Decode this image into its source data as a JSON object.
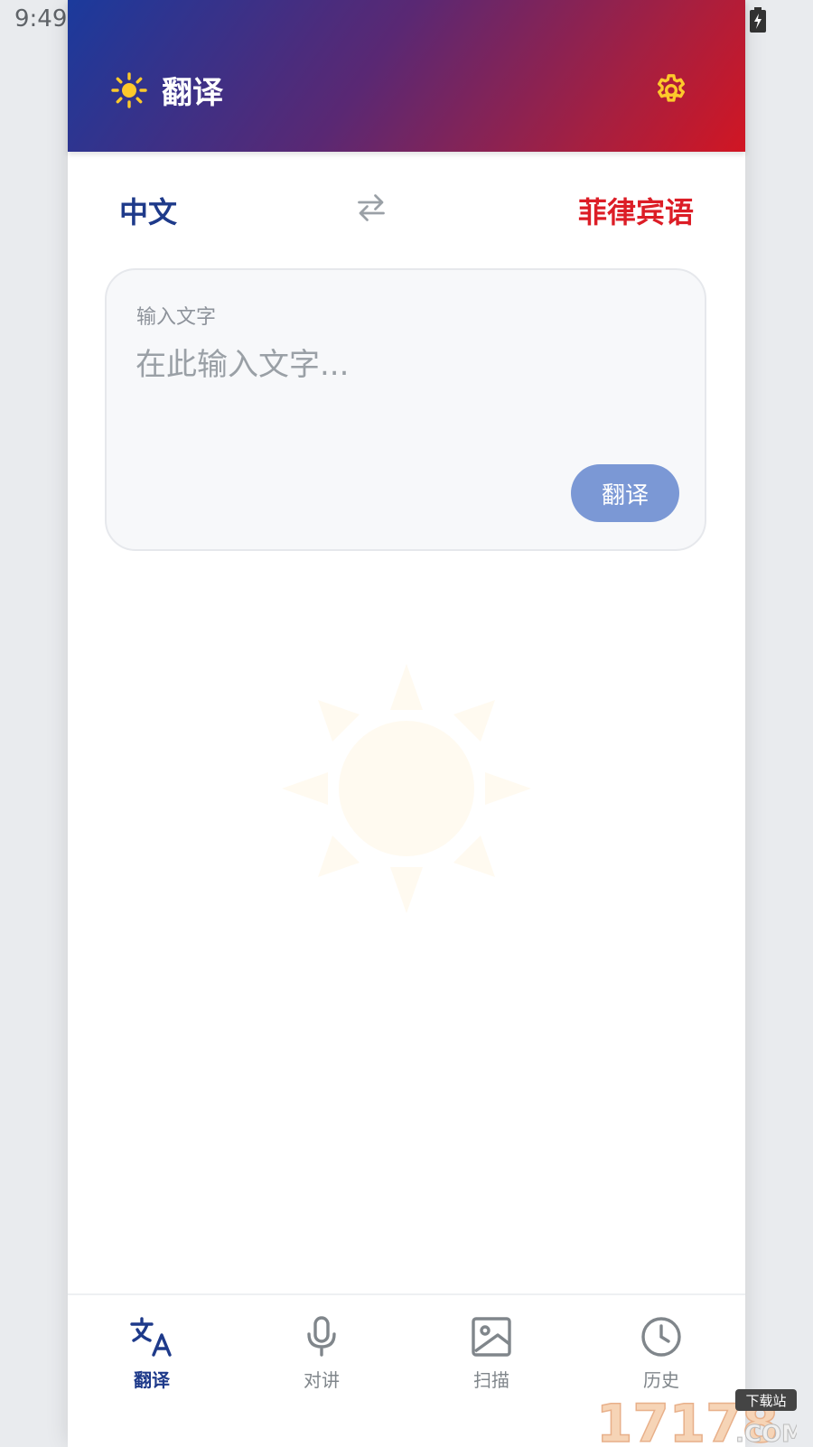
{
  "status_bar": {
    "time": "9:49",
    "icons": [
      "wifi-icon",
      "signal-icon",
      "battery-charging-icon"
    ]
  },
  "header": {
    "title": "翻译",
    "logo_icon": "sun-icon",
    "settings_icon": "gear-icon",
    "gradient_colors": [
      "#1b3a9c",
      "#5a2873",
      "#d11623"
    ],
    "icon_color": "#fdc92b"
  },
  "language_bar": {
    "source": "中文",
    "target": "菲律宾语",
    "swap_icon": "swap-arrows-icon",
    "source_color": "#1e3a8a",
    "target_color": "#dc1d26"
  },
  "input_card": {
    "label": "输入文字",
    "placeholder": "在此输入文字...",
    "value": "",
    "translate_button": "翻译",
    "button_color": "#7b98d5"
  },
  "background_decoration": "sun-watermark-icon",
  "bottom_nav": {
    "items": [
      {
        "label": "翻译",
        "icon": "translate-icon",
        "active": true
      },
      {
        "label": "对讲",
        "icon": "microphone-icon",
        "active": false
      },
      {
        "label": "扫描",
        "icon": "image-icon",
        "active": false
      },
      {
        "label": "历史",
        "icon": "clock-icon",
        "active": false
      }
    ],
    "active_color": "#1e3a8a",
    "inactive_color": "#80868b"
  },
  "watermark": {
    "brand": "17178",
    "suffix": ".COM",
    "badge": "下载站"
  }
}
